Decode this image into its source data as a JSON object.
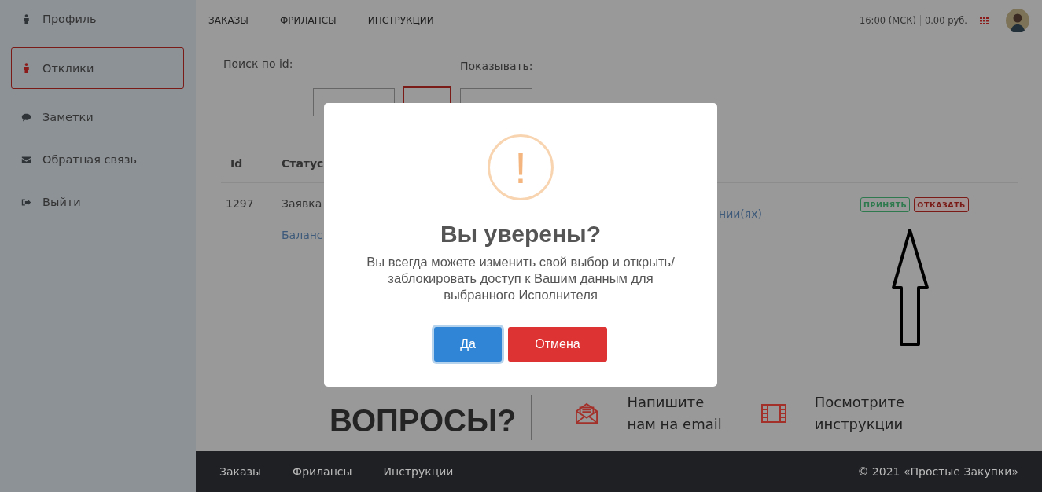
{
  "sidebar": {
    "items": [
      {
        "label": "Профиль",
        "kind": "person",
        "selected": false
      },
      {
        "label": "Отклики",
        "kind": "person",
        "selected": true
      },
      {
        "label": "Заметки",
        "kind": "chat",
        "selected": false
      },
      {
        "label": "Обратная связь",
        "kind": "mail",
        "selected": false
      },
      {
        "label": "Выйти",
        "kind": "exit",
        "selected": false
      }
    ]
  },
  "top_nav": [
    "ЗАКАЗЫ",
    "ФРИЛАНСЫ",
    "ИНСТРУКЦИИ"
  ],
  "header": {
    "time": "16:00 (МСК)",
    "balance": "0.00 руб."
  },
  "filters": {
    "search_label": "Поиск по id:",
    "show_label": "Показывать:"
  },
  "table": {
    "columns": [
      "Id",
      "Статус"
    ],
    "rows": [
      {
        "id": "1297",
        "status": "Заявка",
        "link": "Баланс",
        "column_3": "нии(ях)",
        "actions": [
          {
            "label": "ПРИНЯТЬ",
            "kind": "accept"
          },
          {
            "label": "ОТКАЗАТЬ",
            "kind": "reject"
          }
        ]
      }
    ]
  },
  "contact": {
    "heading": "ВОПРОСЫ?",
    "items": [
      {
        "kind": "email",
        "lines": [
          "Напишите",
          "нам на email"
        ]
      },
      {
        "kind": "video",
        "lines": [
          "Посмотрите",
          "инструкции"
        ]
      }
    ]
  },
  "footer": {
    "links": [
      "Заказы",
      "Фрилансы",
      "Инструкции"
    ],
    "copyright": "© 2021 «Простые Закупки»"
  },
  "dialog": {
    "icon": "!",
    "title": "Вы уверены?",
    "message": "Вы всегда можете изменить свой выбор и открыть/ заблокировать доступ к Вашим данным для выбранного Исполнителя",
    "buttons": [
      {
        "label": "Да",
        "kind": "confirm"
      },
      {
        "label": "Отмена",
        "kind": "cancel"
      }
    ]
  }
}
